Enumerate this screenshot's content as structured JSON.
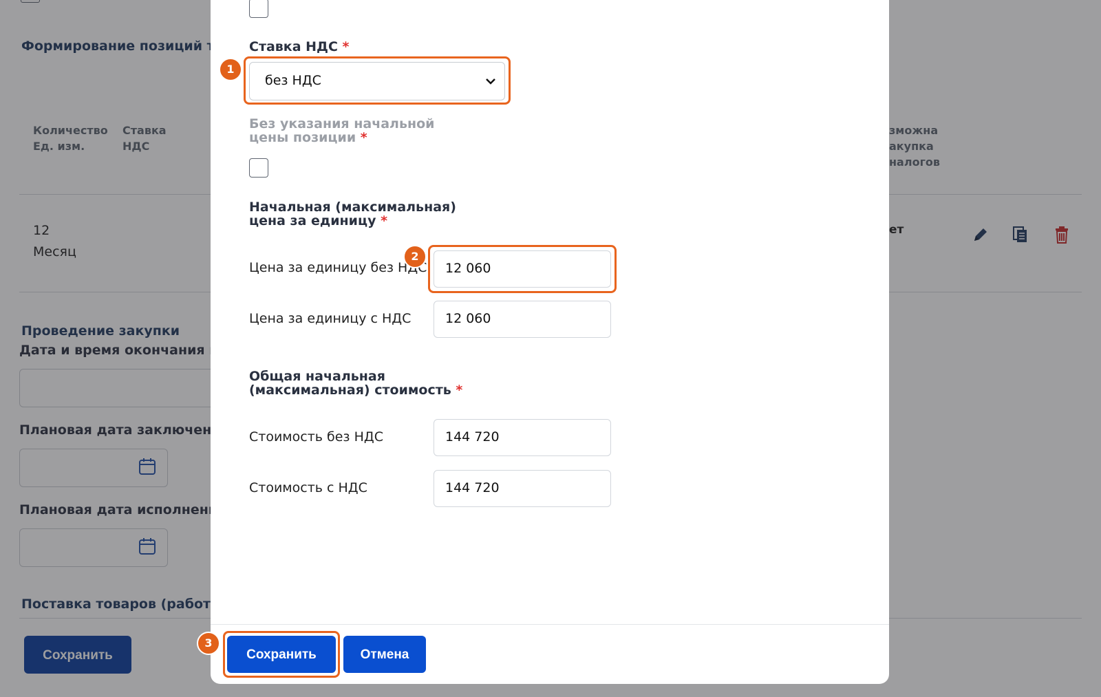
{
  "background": {
    "section_title": "Формирование позиций то",
    "col_qty": "Количество Ед. изм.",
    "col_vat": "Ставка НДС",
    "col_possible": "зможна акупка налогов",
    "row_qty": "12",
    "row_unit": "Месяц",
    "row_flag": "ет",
    "procurement_title": "Проведение закупки",
    "end_date_label": "Дата и время окончания пр",
    "planned_contract_label": "Плановая дата заключения",
    "planned_exec_label": "Плановая дата исполнения",
    "delivery_title": "Поставка товаров (работ, у",
    "save_label": "Сохранить"
  },
  "dialog": {
    "vat_rate_label": "Ставка НДС",
    "vat_rate_value": "без НДС",
    "no_start_price_label": "Без указания начальной цены позиции",
    "start_price_label": "Начальная (максимальная) цена за единицу",
    "unit_price_no_vat_label": "Цена за единицу без НДС",
    "unit_price_no_vat_value": "12 060",
    "unit_price_with_vat_label": "Цена за единицу с НДС",
    "unit_price_with_vat_value": "12 060",
    "total_label": "Общая начальная (максимальная) стоимость",
    "total_no_vat_label": "Стоимость без НДС",
    "total_no_vat_value": "144 720",
    "total_with_vat_label": "Стоимость с НДС",
    "total_with_vat_value": "144 720",
    "required_mark": "*",
    "save_label": "Сохранить",
    "cancel_label": "Отмена"
  },
  "annotations": {
    "step1": "1",
    "step2": "2",
    "step3": "3"
  },
  "colors": {
    "primary": "#0a4fd0",
    "highlight": "#e8641e",
    "required": "#e0312f",
    "delete_icon": "#c62828"
  },
  "icons": [
    "calendar-icon",
    "pencil-icon",
    "copy-icon",
    "trash-icon",
    "chevron-down-icon"
  ]
}
